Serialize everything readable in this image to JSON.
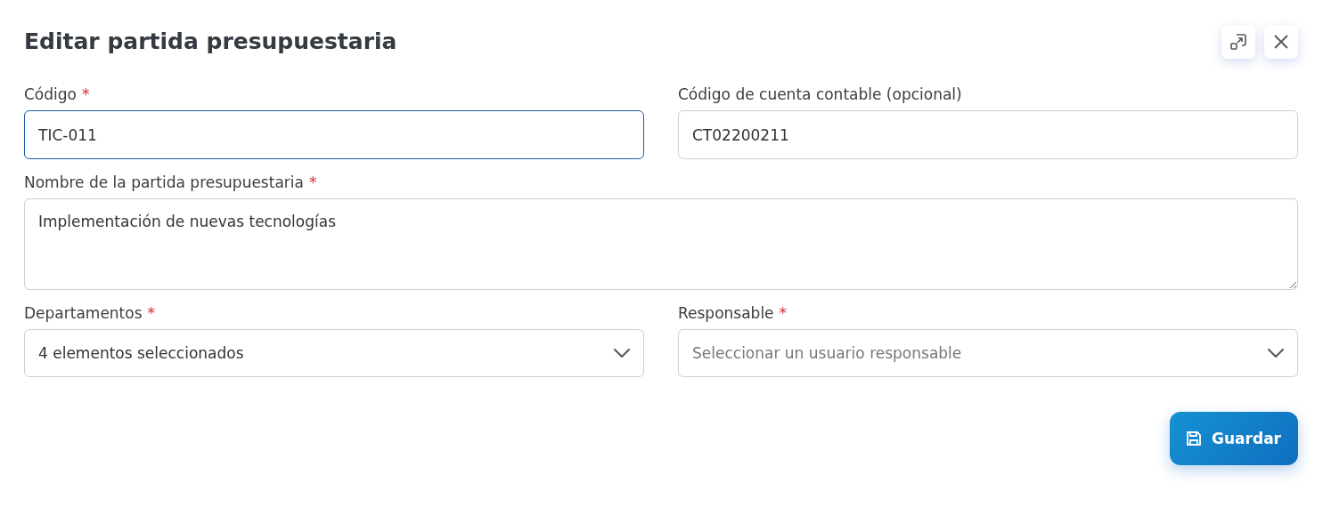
{
  "dialog": {
    "title": "Editar partida presupuestaria"
  },
  "header_buttons": [
    {
      "kind": "restore"
    },
    {
      "kind": "close"
    }
  ],
  "rows": [
    {
      "fields": [
        {
          "kind": "input",
          "label": "Código",
          "required_mark": "*",
          "focused": true,
          "value": "TIC-011"
        },
        {
          "kind": "input",
          "label": "Código de cuenta contable (opcional)",
          "focused": false,
          "value": "CT02200211"
        }
      ]
    },
    {
      "fields": [
        {
          "kind": "textarea",
          "label": "Nombre de la partida presupuestaria",
          "required_mark": "*",
          "focused": false,
          "value": "Implementación de nuevas tecnologías"
        }
      ]
    },
    {
      "fields": [
        {
          "kind": "select",
          "label": "Departamentos",
          "required_mark": "*",
          "focused": false,
          "value": "4 elementos seleccionados"
        },
        {
          "kind": "select",
          "label": "Responsable",
          "required_mark": "*",
          "focused": false,
          "placeholder": "Seleccionar un usuario responsable"
        }
      ]
    }
  ],
  "save_button": {
    "label": "Guardar"
  }
}
